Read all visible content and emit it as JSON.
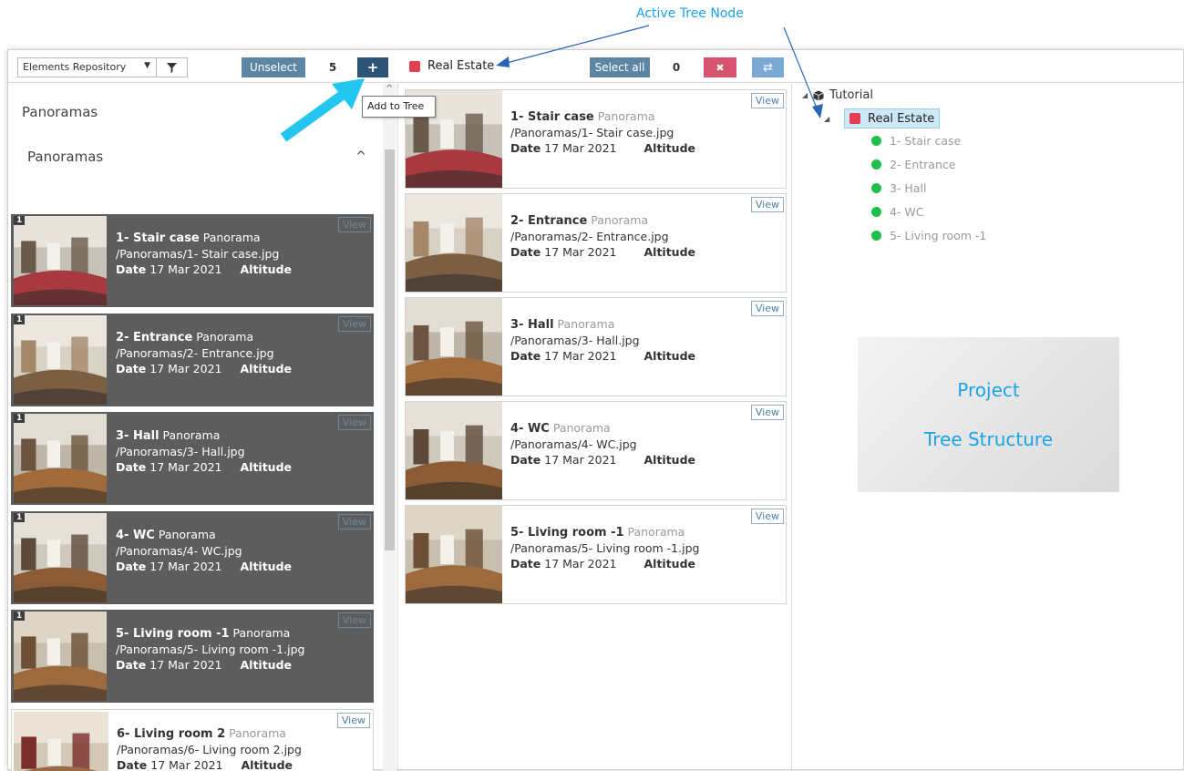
{
  "annotation": {
    "title": "Active Tree Node",
    "tooltip": "Add to Tree",
    "project_box": [
      "Project",
      "Tree Structure"
    ],
    "colors": {
      "annotation_text": "#1aa3e8",
      "arrow_cyan": "#22c6ef",
      "arrow_line": "#2b63b8"
    }
  },
  "toolbar": {
    "repository_select": "Elements Repository",
    "unselect_label": "Unselect",
    "selected_count": "5",
    "add_label": "+",
    "active_node_label": "Real Estate",
    "select_all_label": "Select all",
    "tree_selected_count": "0",
    "delete_label": "✖",
    "move_label": "⇄"
  },
  "left_panel": {
    "section_title": "Panoramas",
    "group_title": "Panoramas",
    "cards": [
      {
        "badge": "1",
        "name": "1- Stair case",
        "type": "Panorama",
        "path": "/Panoramas/1- Stair case.jpg",
        "date_label": "Date",
        "date": "17 Mar 2021",
        "altitude_label": "Altitude",
        "view": "View",
        "selected": true
      },
      {
        "badge": "1",
        "name": "2- Entrance",
        "type": "Panorama",
        "path": "/Panoramas/2- Entrance.jpg",
        "date_label": "Date",
        "date": "17 Mar 2021",
        "altitude_label": "Altitude",
        "view": "View",
        "selected": true
      },
      {
        "badge": "1",
        "name": "3- Hall",
        "type": "Panorama",
        "path": "/Panoramas/3- Hall.jpg",
        "date_label": "Date",
        "date": "17 Mar 2021",
        "altitude_label": "Altitude",
        "view": "View",
        "selected": true
      },
      {
        "badge": "1",
        "name": "4- WC",
        "type": "Panorama",
        "path": "/Panoramas/4- WC.jpg",
        "date_label": "Date",
        "date": "17 Mar 2021",
        "altitude_label": "Altitude",
        "view": "View",
        "selected": true
      },
      {
        "badge": "1",
        "name": "5- Living room -1",
        "type": "Panorama",
        "path": "/Panoramas/5- Living room -1.jpg",
        "date_label": "Date",
        "date": "17 Mar 2021",
        "altitude_label": "Altitude",
        "view": "View",
        "selected": true
      },
      {
        "badge": "",
        "name": "6- Living room 2",
        "type": "Panorama",
        "path": "/Panoramas/6- Living room 2.jpg",
        "date_label": "Date",
        "date": "17 Mar 2021",
        "altitude_label": "Altitude",
        "view": "View",
        "selected": false
      }
    ]
  },
  "middle_panel": {
    "cards": [
      {
        "name": "1- Stair case",
        "type": "Panorama",
        "path": "/Panoramas/1- Stair case.jpg",
        "date_label": "Date",
        "date": "17 Mar 2021",
        "altitude_label": "Altitude",
        "view": "View"
      },
      {
        "name": "2- Entrance",
        "type": "Panorama",
        "path": "/Panoramas/2- Entrance.jpg",
        "date_label": "Date",
        "date": "17 Mar 2021",
        "altitude_label": "Altitude",
        "view": "View"
      },
      {
        "name": "3- Hall",
        "type": "Panorama",
        "path": "/Panoramas/3- Hall.jpg",
        "date_label": "Date",
        "date": "17 Mar 2021",
        "altitude_label": "Altitude",
        "view": "View"
      },
      {
        "name": "4- WC",
        "type": "Panorama",
        "path": "/Panoramas/4- WC.jpg",
        "date_label": "Date",
        "date": "17 Mar 2021",
        "altitude_label": "Altitude",
        "view": "View"
      },
      {
        "name": "5- Living room -1",
        "type": "Panorama",
        "path": "/Panoramas/5- Living room -1.jpg",
        "date_label": "Date",
        "date": "17 Mar 2021",
        "altitude_label": "Altitude",
        "view": "View"
      }
    ]
  },
  "tree": {
    "root": "Tutorial",
    "active": "Real Estate",
    "children": [
      "1- Stair case",
      "2- Entrance",
      "3- Hall",
      "4- WC",
      "5- Living room -1"
    ]
  }
}
